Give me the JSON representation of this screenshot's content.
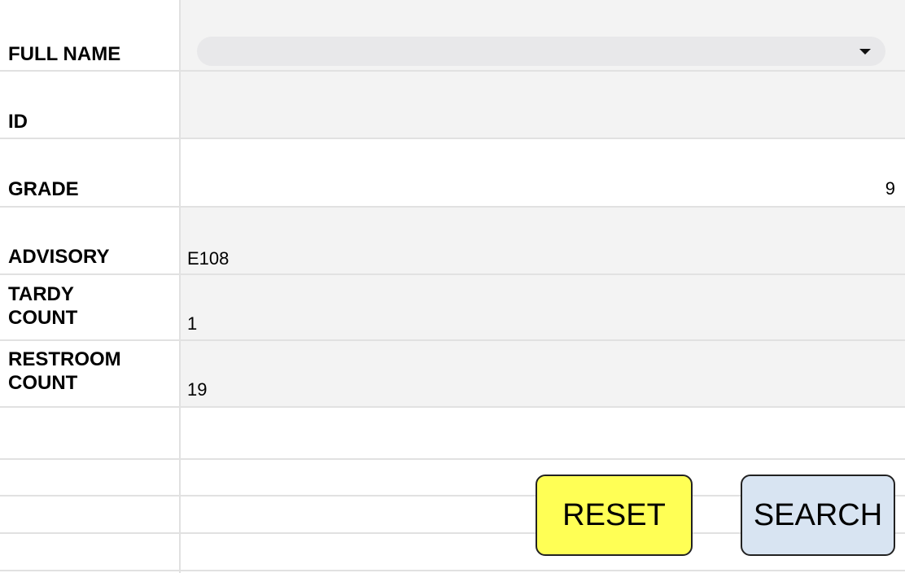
{
  "form": {
    "full_name": {
      "label": "FULL NAME",
      "value": ""
    },
    "id": {
      "label": "ID",
      "value": ""
    },
    "grade": {
      "label": "GRADE",
      "value": "9"
    },
    "advisory": {
      "label": "ADVISORY",
      "value": "E108"
    },
    "tardy_count": {
      "label": "TARDY\nCOUNT",
      "value": "1"
    },
    "restroom_count": {
      "label": "RESTROOM\nCOUNT",
      "value": "19"
    }
  },
  "buttons": {
    "reset_label": "RESET",
    "search_label": "SEARCH"
  },
  "colors": {
    "reset_button": "#ffff55",
    "search_button": "#d8e4f2",
    "cell_fill": "#f3f3f3",
    "grid_line": "#e1e1e1"
  },
  "icons": {
    "dropdown": "chevron-down-icon"
  }
}
